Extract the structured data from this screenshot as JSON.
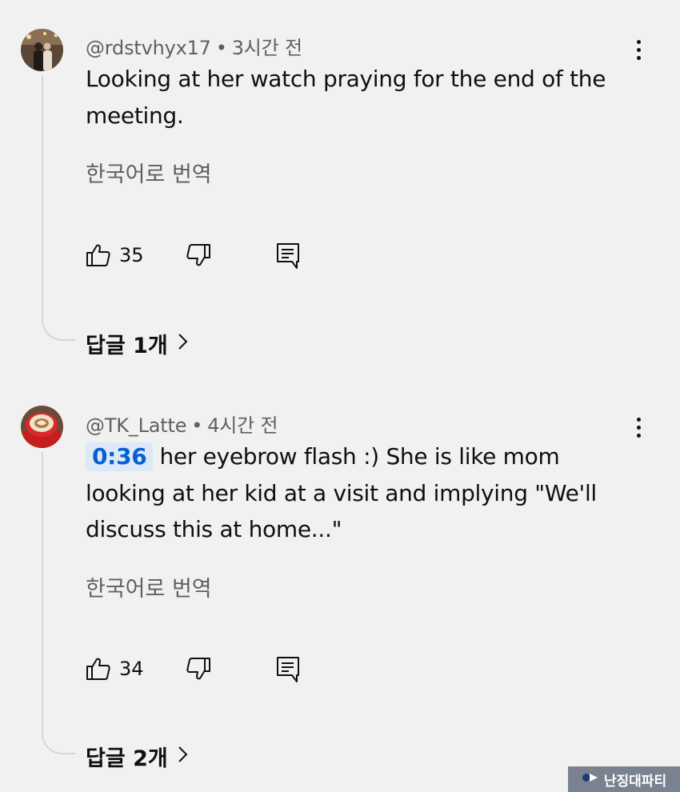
{
  "comments": [
    {
      "author": "@rdstvhyx17",
      "separator": "•",
      "time": "3시간 전",
      "timestamp_link": "",
      "text": "Looking at her watch praying for the end of the meeting.",
      "translate": "한국어로 번역",
      "likes": "35",
      "replies": "답글 1개"
    },
    {
      "author": "@TK_Latte",
      "separator": "•",
      "time": "4시간 전",
      "timestamp_link": "0:36",
      "text": "her eyebrow flash :) She is like mom looking at her kid at a visit and implying \"We'll discuss this at home...\"",
      "translate": "한국어로 번역",
      "likes": "34",
      "replies": "답글 2개"
    }
  ],
  "icons": {
    "more": "more-vert-icon",
    "like": "thumbs-up-icon",
    "dislike": "thumbs-down-icon",
    "reply": "comment-reply-icon",
    "chevron": "chevron-right-icon"
  },
  "colors": {
    "background": "#f1f1f1",
    "meta_text": "#606060",
    "timestamp_link": "#065fd4",
    "timestamp_bg": "#dde9f7"
  },
  "watermark": {
    "text": "난징대파티"
  }
}
